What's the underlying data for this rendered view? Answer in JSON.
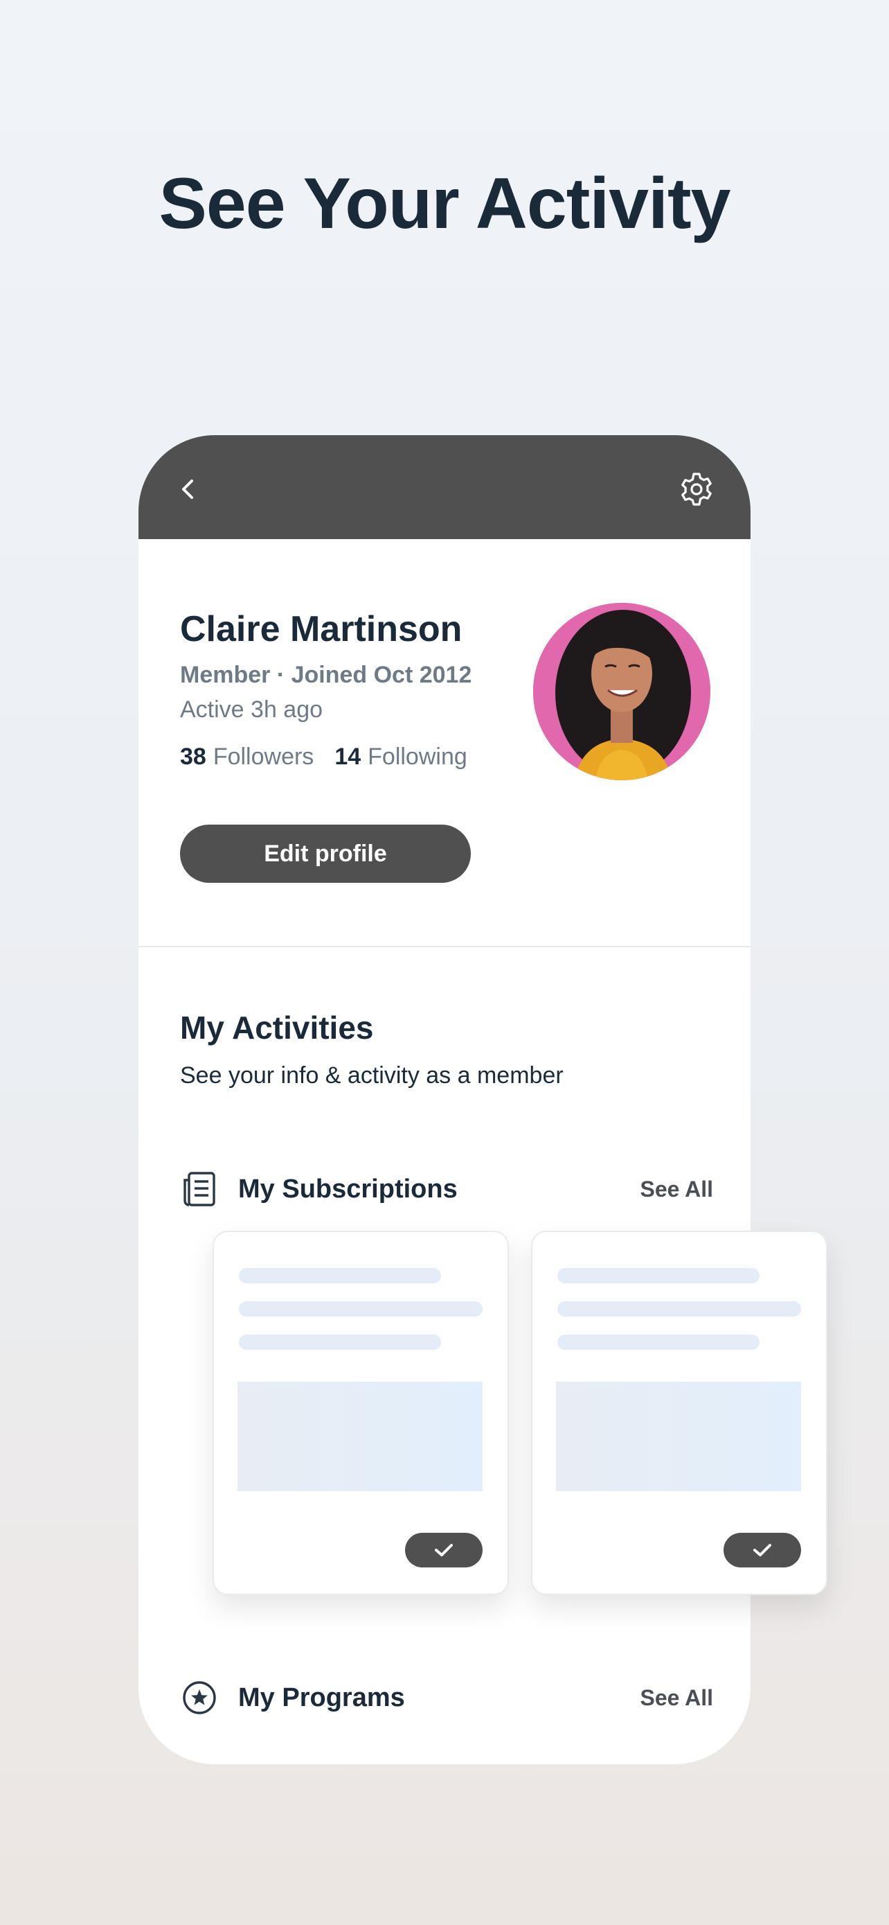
{
  "headline": "See Your Activity",
  "profile": {
    "name": "Claire Martinson",
    "meta": "Member · Joined Oct 2012",
    "active": "Active 3h ago",
    "followers_count": "38",
    "followers_label": "Followers",
    "following_count": "14",
    "following_label": "Following",
    "edit_label": "Edit profile"
  },
  "activities": {
    "title": "My Activities",
    "subtitle": "See your info & activity as a member",
    "subscriptions_label": "My Subscriptions",
    "programs_label": "My Programs",
    "see_all": "See All"
  },
  "icons": {
    "back": "chevron-left-icon",
    "settings": "gear-icon",
    "subscriptions": "newspaper-icon",
    "programs": "star-circle-icon",
    "check": "check-icon"
  },
  "colors": {
    "topbar": "#505050",
    "text_dark": "#1b2a38",
    "text_muted": "#6e7b86",
    "avatar_bg": "#e168ad"
  }
}
